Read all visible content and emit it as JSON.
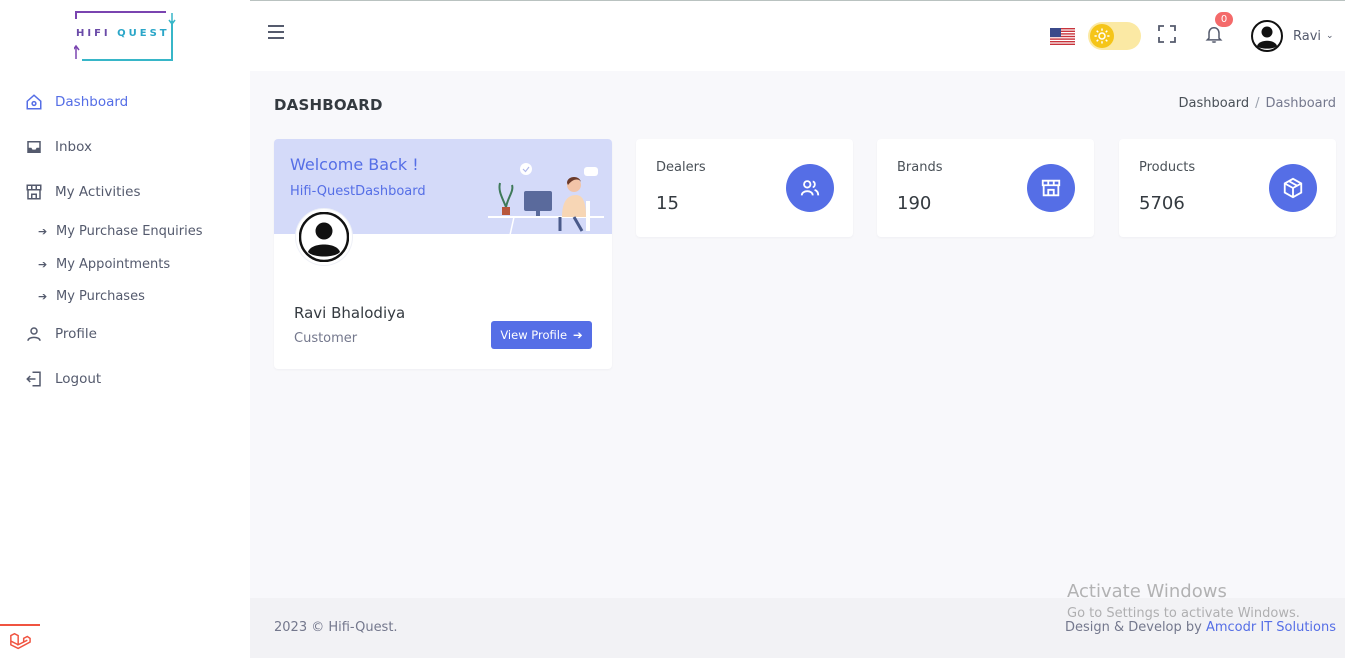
{
  "brand": {
    "logo_text_a": "HIFI",
    "logo_text_b": "QUEST"
  },
  "sidebar": {
    "items": [
      {
        "label": "Dashboard",
        "icon": "home-icon",
        "active": true
      },
      {
        "label": "Inbox",
        "icon": "inbox-icon"
      },
      {
        "label": "My Activities",
        "icon": "store-icon"
      },
      {
        "label": "Profile",
        "icon": "user-icon"
      },
      {
        "label": "Logout",
        "icon": "logout-icon"
      }
    ],
    "sub_items": [
      {
        "label": "My Purchase Enquiries"
      },
      {
        "label": "My Appointments"
      },
      {
        "label": "My Purchases"
      }
    ]
  },
  "header": {
    "notification_count": "0",
    "user_name": "Ravi",
    "language_flag": "us-flag-icon"
  },
  "page": {
    "title": "DASHBOARD",
    "breadcrumb": [
      "Dashboard",
      "Dashboard"
    ]
  },
  "welcome": {
    "title": "Welcome Back !",
    "subtitle": "Hifi-QuestDashboard",
    "user_name": "Ravi Bhalodiya",
    "role": "Customer",
    "button_label": "View Profile"
  },
  "stats": [
    {
      "label": "Dealers",
      "value": "15",
      "icon": "users-icon"
    },
    {
      "label": "Brands",
      "value": "190",
      "icon": "store-icon"
    },
    {
      "label": "Products",
      "value": "5706",
      "icon": "box-icon"
    }
  ],
  "footer": {
    "copyright": "2023 © Hifi-Quest.",
    "credit_prefix": "Design & Develop by ",
    "credit_link": "Amcodr IT Solutions"
  },
  "watermark": {
    "line1": "Activate Windows",
    "line2": "Go to Settings to activate Windows."
  },
  "colors": {
    "accent": "#556ee6",
    "banner": "#d4daf9",
    "badge": "#f46a6a"
  }
}
